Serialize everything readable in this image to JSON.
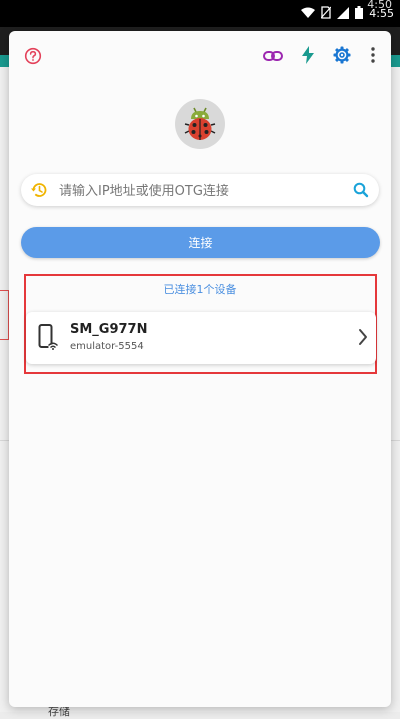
{
  "status_bar": {
    "time": "4:55",
    "time_behind": "4:50",
    "icons": [
      "wifi-icon",
      "no-sim-icon",
      "signal-icon",
      "battery-icon"
    ]
  },
  "background": {
    "bottom_text": "存储"
  },
  "toolbar": {
    "help_icon": "help-circle-icon",
    "link_icon": "link-icon",
    "flash_icon": "flash-icon",
    "settings_icon": "gear-icon",
    "more_icon": "more-vert-icon"
  },
  "logo": {
    "icon": "ladybug-android-icon"
  },
  "search": {
    "placeholder": "请输入IP地址或使用OTG连接",
    "value": ""
  },
  "connect_button": {
    "label": "连接"
  },
  "devices": {
    "status": "已连接1个设备",
    "items": [
      {
        "name": "SM_G977N",
        "id": "emulator-5554",
        "icon": "phone-wifi-icon"
      }
    ]
  },
  "colors": {
    "accent_blue": "#5b9be8",
    "help_red": "#e3415a",
    "link_purple": "#9c27b0",
    "flash_teal": "#1a9a8f",
    "settings_blue": "#1976d2",
    "history_amber": "#f0b400",
    "search_cyan": "#1aa3d9",
    "highlight_red": "#e5383b"
  }
}
